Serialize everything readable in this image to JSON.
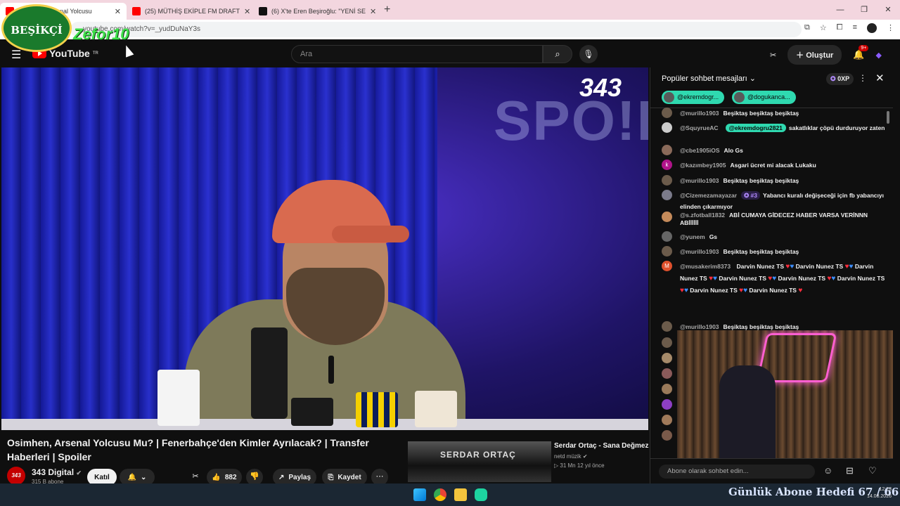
{
  "browser": {
    "tabs": [
      {
        "title": "Osimhen, Arsenal Yolcusu",
        "active": true
      },
      {
        "title": "(25) MÜTHİŞ EKİPLE FM DRAFT",
        "active": false
      },
      {
        "title": "(6) X'te Eren Beşiroğlu: \"YENİ SE",
        "active": false
      }
    ],
    "url": "youtube.com/watch?v=_yudDuNaY3s"
  },
  "youtube": {
    "logo_text": "YouTube",
    "region": "TR",
    "search_placeholder": "Ara",
    "create_label": "Oluştur",
    "notifications": "9+"
  },
  "video": {
    "title": "Osimhen, Arsenal Yolcusu Mu? | Fenerbahçe'den Kimler Ayrılacak? | Transfer Haberleri | Spoiler",
    "overlay_logo": "343",
    "backdrop_text": "SPO!L",
    "channel": {
      "name": "343 Digital",
      "avatar_text": "343",
      "subscribers": "315 B abone"
    },
    "join_label": "Katıl",
    "likes": "882",
    "share_label": "Paylaş",
    "save_label": "Kaydet"
  },
  "related": {
    "title": "Serdar Ortaç - Sana Değmez",
    "channel": "netd müzik",
    "meta": "▷ 31 Mn   12 yıl önce",
    "thumb_text": "SERDAR ORTAÇ"
  },
  "chat": {
    "header": "Popüler sohbet mesajları",
    "xp": "0XP",
    "pinned": [
      "@ekremdogr...",
      "@dogukanca..."
    ],
    "messages": [
      {
        "user": "@murillo1903",
        "text": "Beşiktaş beşiktaş beşiktaş"
      },
      {
        "user": "@SquyrueAC",
        "mention": "@ekremdogru2821",
        "text": "sakatlıklar çöpü durduruyor zaten"
      },
      {
        "user": "@cbe1905iOS",
        "text": "Alo Gs"
      },
      {
        "user": "@kazımbey1905",
        "text": "Asgari ücret mi alacak Lukaku",
        "avatar_letter": "k"
      },
      {
        "user": "@murillo1903",
        "text": "Beşiktaş beşiktaş beşiktaş"
      },
      {
        "user": "@Cizemezamayazar",
        "rank": "#3",
        "text": "Yabancı kuralı değişeceği için fb yabancıyı elinden çıkarmıyor"
      },
      {
        "user": "@s.zfotball1832",
        "text": "ABİ CUMAYA GİDECEZ HABER VARSA VERİNNN ABİİİİİİ"
      },
      {
        "user": "@yunem",
        "text": "Gs"
      },
      {
        "user": "@murillo1903",
        "text": "Beşiktaş beşiktaş beşiktaş"
      },
      {
        "user": "@musakerim8373",
        "text": "Darvin Nunez TS",
        "avatar_letter": "M"
      },
      {
        "user": "@murillo1903",
        "text": "Beşiktaş beşiktaş beşiktaş"
      }
    ],
    "input_placeholder": "Abone olarak sohbet edin..."
  },
  "overlay": {
    "logo": "BEŞİKÇİ",
    "brand": "Zefor10"
  },
  "taskbar": {
    "goal_text": "Günlük Abone Hedefi 67 / 66",
    "time": "12:23",
    "date": "14.08.2026"
  }
}
